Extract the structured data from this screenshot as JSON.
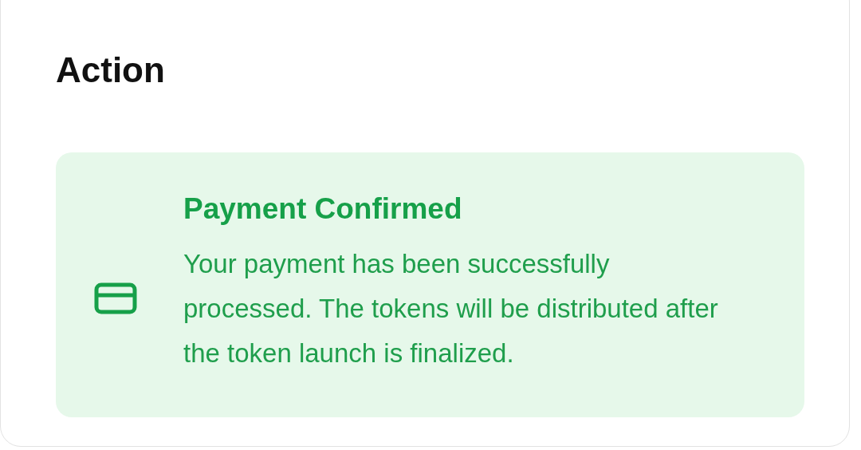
{
  "section": {
    "title": "Action"
  },
  "notice": {
    "kind": "success",
    "title": "Payment Confirmed",
    "message": "Your payment has been successfully processed. The tokens will be distributed after the token launch is finalized."
  }
}
